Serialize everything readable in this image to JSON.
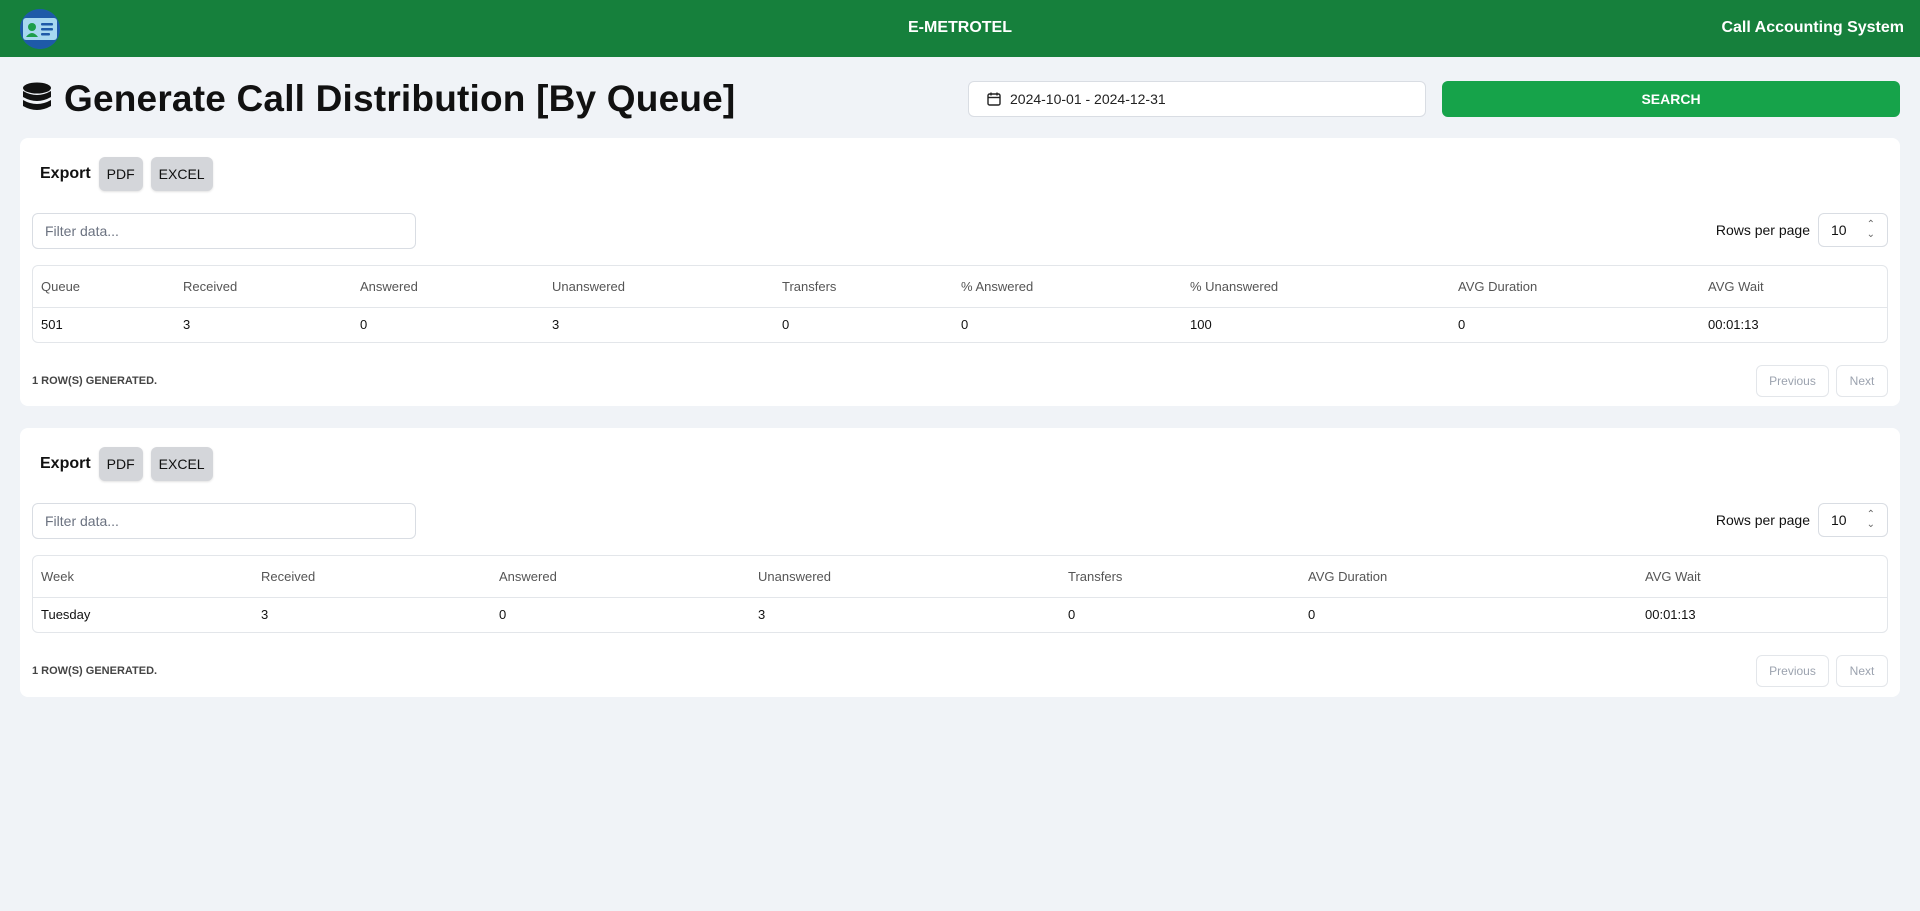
{
  "header": {
    "app_name": "E-METROTEL",
    "system_name": "Call Accounting System"
  },
  "page": {
    "title": "Generate Call Distribution [By Queue]",
    "date_range": "2024-10-01 - 2024-12-31",
    "search_label": "SEARCH"
  },
  "colors": {
    "topbar": "#16803c",
    "search_button": "#16a34a"
  },
  "queue_card": {
    "export_label": "Export",
    "pdf_label": "PDF",
    "excel_label": "EXCEL",
    "filter_placeholder": "Filter data...",
    "rows_per_page_label": "Rows per page",
    "rows_per_page_value": "10",
    "columns": [
      "Queue",
      "Received",
      "Answered",
      "Unanswered",
      "Transfers",
      "% Answered",
      "% Unanswered",
      "AVG Duration",
      "AVG Wait"
    ],
    "rows": [
      [
        "501",
        "3",
        "0",
        "3",
        "0",
        "0",
        "100",
        "0",
        "00:01:13"
      ]
    ],
    "rows_generated": "1 ROW(S) GENERATED.",
    "previous_label": "Previous",
    "next_label": "Next"
  },
  "week_card": {
    "export_label": "Export",
    "pdf_label": "PDF",
    "excel_label": "EXCEL",
    "filter_placeholder": "Filter data...",
    "rows_per_page_label": "Rows per page",
    "rows_per_page_value": "10",
    "columns": [
      "Week",
      "Received",
      "Answered",
      "Unanswered",
      "Transfers",
      "AVG Duration",
      "AVG Wait"
    ],
    "rows": [
      [
        "Tuesday",
        "3",
        "0",
        "3",
        "0",
        "0",
        "00:01:13"
      ]
    ],
    "rows_generated": "1 ROW(S) GENERATED.",
    "previous_label": "Previous",
    "next_label": "Next"
  }
}
